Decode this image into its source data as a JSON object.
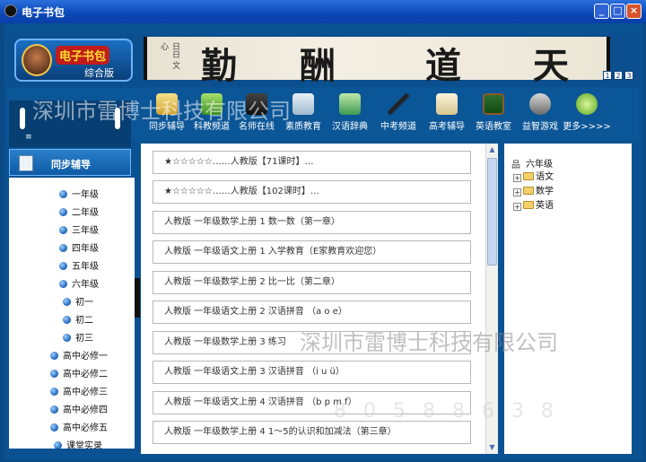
{
  "window": {
    "title": "电子书包"
  },
  "logo": {
    "text": "电子书包",
    "sub": "综合版"
  },
  "banner": {
    "seal": "日日 文心",
    "chars": [
      "勤",
      "酬",
      "道",
      "天"
    ],
    "pages": [
      "1",
      "2",
      "3"
    ]
  },
  "nav": [
    {
      "label": "同步辅导",
      "icon": "book-icon"
    },
    {
      "label": "科教频道",
      "icon": "monitor-icon"
    },
    {
      "label": "名师在线",
      "icon": "teacher-icon"
    },
    {
      "label": "素质教育",
      "icon": "quality-icon"
    },
    {
      "label": "汉语辞典",
      "icon": "dictionary-icon"
    },
    {
      "label": "中考频道",
      "icon": "pen-icon"
    },
    {
      "label": "高考辅导",
      "icon": "paper-icon"
    },
    {
      "label": "英语教室",
      "icon": "blackboard-icon"
    },
    {
      "label": "益智游戏",
      "icon": "game-icon"
    },
    {
      "label": "更多>>>>",
      "icon": "more-icon"
    }
  ],
  "sidebar": {
    "header": "同步辅导",
    "items": [
      "一年级",
      "二年级",
      "三年级",
      "四年级",
      "五年级",
      "六年级"
    ],
    "subitems": [
      "初一",
      "初二",
      "初三"
    ],
    "high": [
      "高中必修一",
      "高中必修二",
      "高中必修三",
      "高中必修四",
      "高中必修五"
    ],
    "last": "课堂实录"
  },
  "list": [
    "★☆☆☆☆☆……人教版【71课时】…",
    "★☆☆☆☆☆……人教版【102课时】…",
    "人教版 一年级数学上册 1 数一数（第一章）",
    "人教版 一年级语文上册 1 入学教育（E家教育欢迎您）",
    "人教版 一年级数学上册 2 比一比（第二章）",
    "人教版 一年级语文上册 2 汉语拼音 （a o e）",
    "人教版 一年级数学上册 3 练习",
    "人教版 一年级语文上册 3 汉语拼音 （i u ü）",
    "人教版 一年级语文上册 4 汉语拼音 （b p m f）",
    "人教版 一年级数学上册 4 1～5的认识和加减法（第三章）"
  ],
  "tree": {
    "root": "六年级",
    "children": [
      "语文",
      "数学",
      "英语"
    ]
  },
  "watermark": {
    "company": "深圳市雷博士科技有限公司",
    "code": "8 0 5 8 8 6 3 8"
  }
}
